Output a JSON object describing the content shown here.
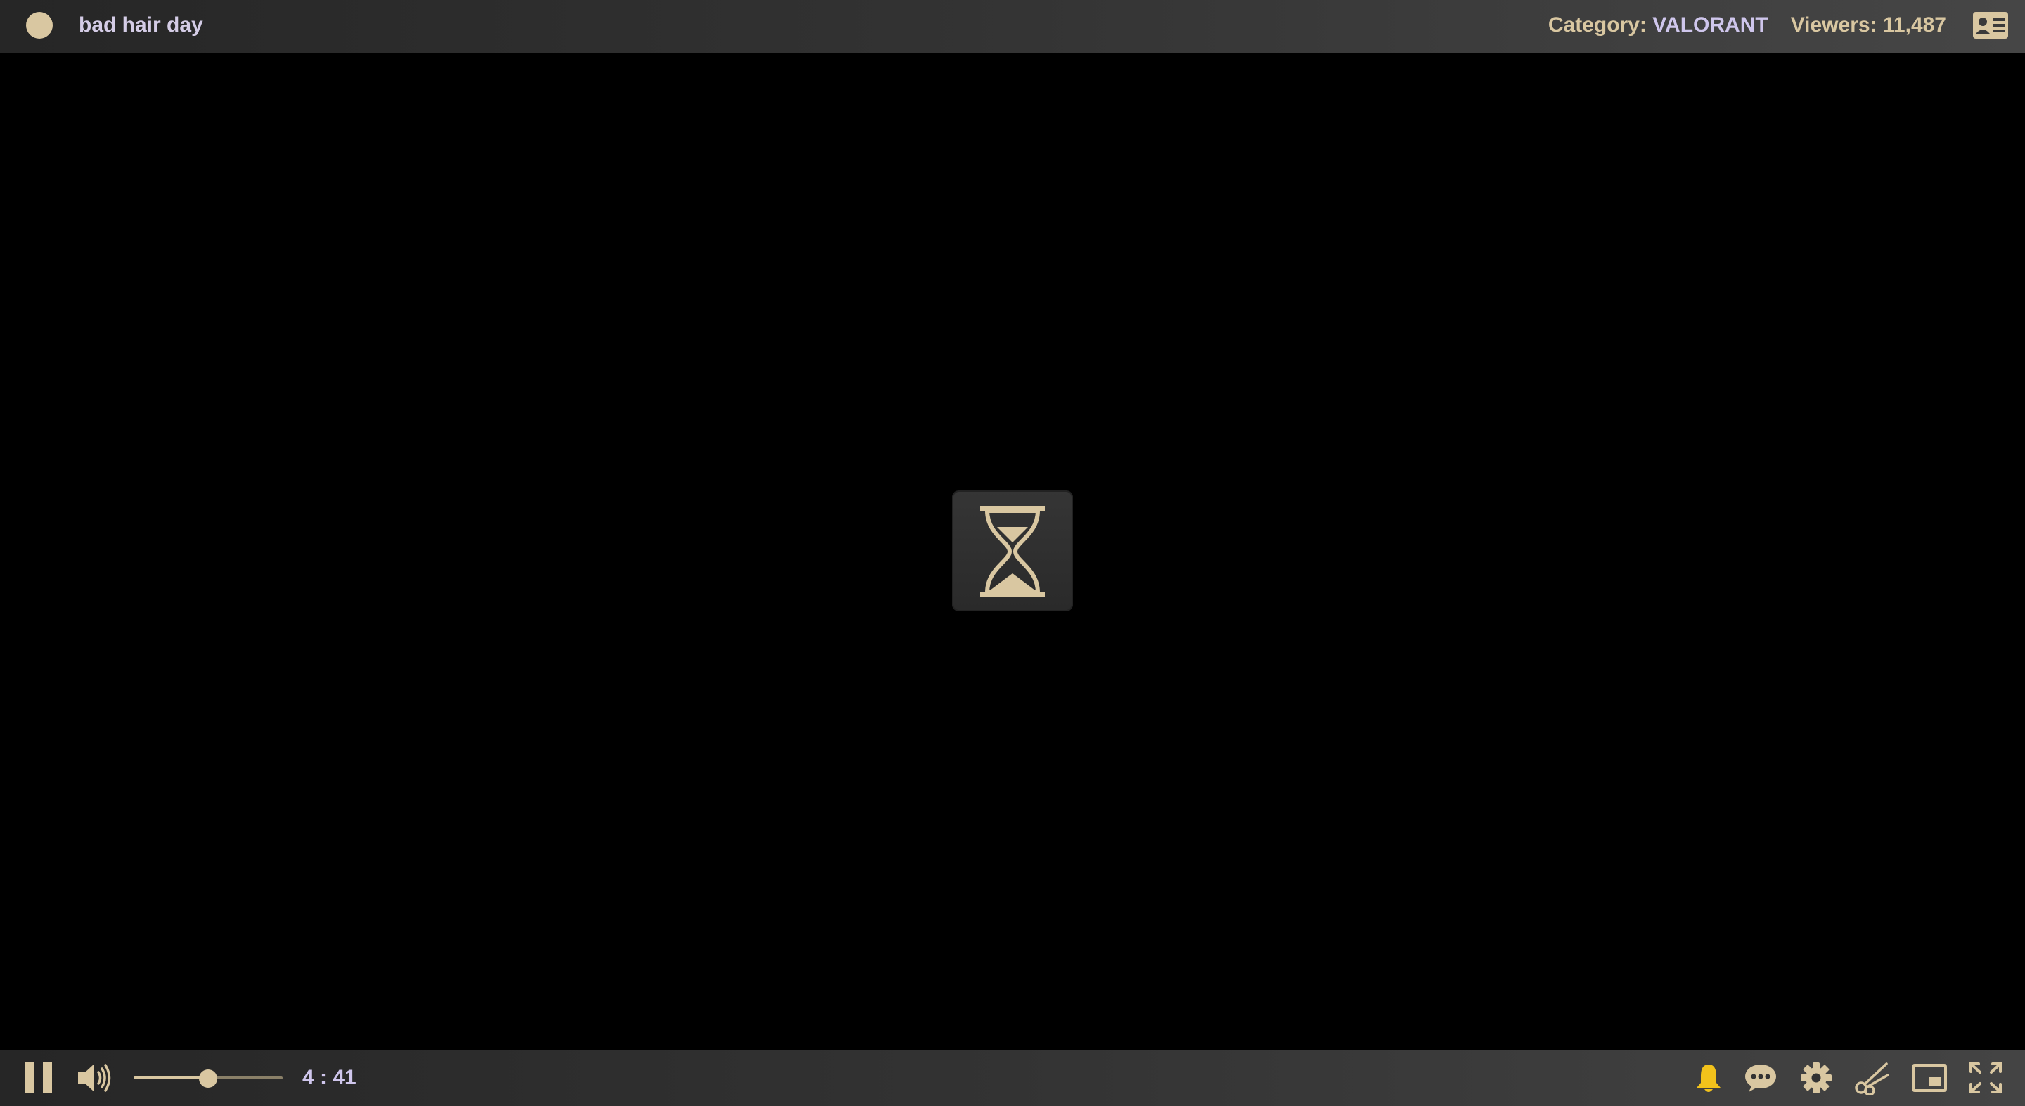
{
  "stream": {
    "title": "bad hair day",
    "category_label": "Category:",
    "category_value": "VALORANT",
    "viewers_label": "Viewers:",
    "viewers_value": "11,487"
  },
  "icons": {
    "live_indicator": "status-dot",
    "profile": "profile-card-icon",
    "loading": "hourglass-icon",
    "pause": "pause-icon",
    "volume": "speaker-icon",
    "notifications": "bell-icon",
    "chat": "chat-bubble-icon",
    "settings": "gear-icon",
    "clip": "scissors-icon",
    "pip": "picture-in-picture-icon",
    "fullscreen": "fullscreen-icon"
  },
  "controls": {
    "volume_level": 0.5,
    "time": "4 : 41"
  },
  "colors": {
    "accent_gold": "#d9c7a1",
    "accent_lavender": "#cfc6ec",
    "bell_yellow": "#f2c21b"
  }
}
